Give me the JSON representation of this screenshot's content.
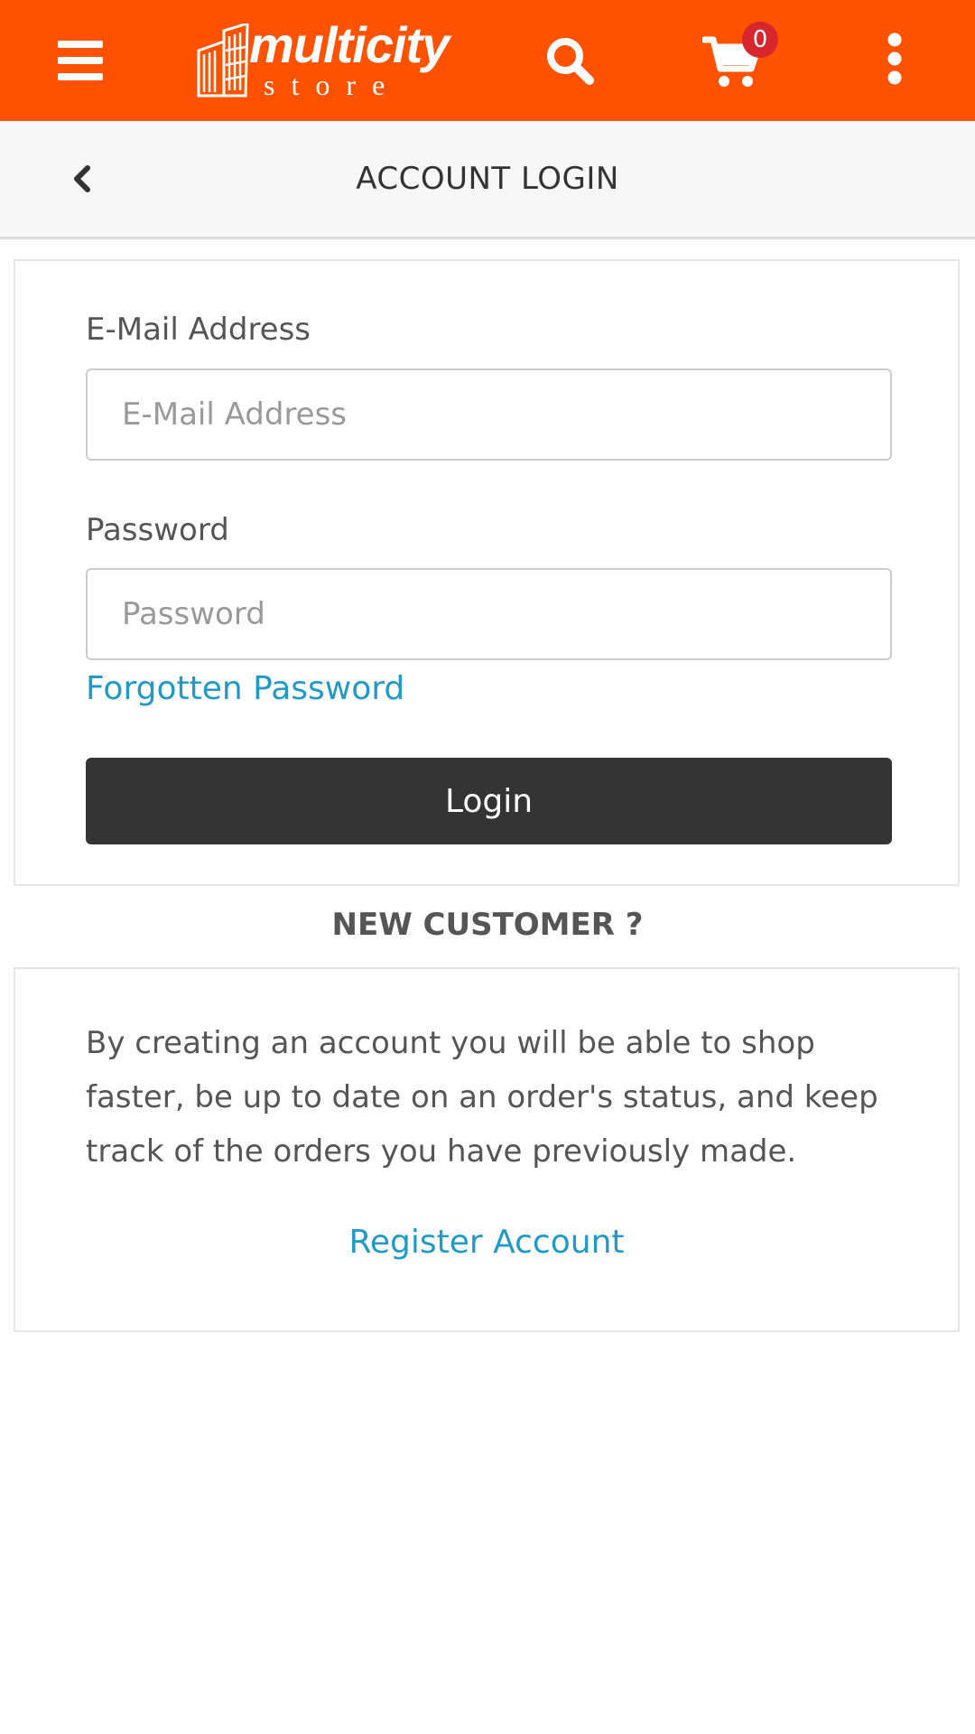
{
  "header": {
    "logo_text": "multicity",
    "logo_subtext": "store",
    "cart_count": "0",
    "colors": {
      "bar": "#ff5200",
      "badge": "#d7262c"
    },
    "icons": [
      "menu-icon",
      "search-icon",
      "cart-icon",
      "more-vertical-icon"
    ]
  },
  "subheader": {
    "title": "ACCOUNT LOGIN",
    "back_icon": "chevron-left-icon"
  },
  "login": {
    "email_label": "E-Mail Address",
    "email_placeholder": "E-Mail Address",
    "email_value": "",
    "password_label": "Password",
    "password_placeholder": "Password",
    "password_value": "",
    "forgot_link": "Forgotten Password",
    "login_button": "Login"
  },
  "new_customer": {
    "heading": "NEW CUSTOMER ?",
    "description": "By creating an account you will be able to shop faster, be up to date on an order's status, and keep track of the orders you have previously made.",
    "register_link": "Register Account"
  }
}
